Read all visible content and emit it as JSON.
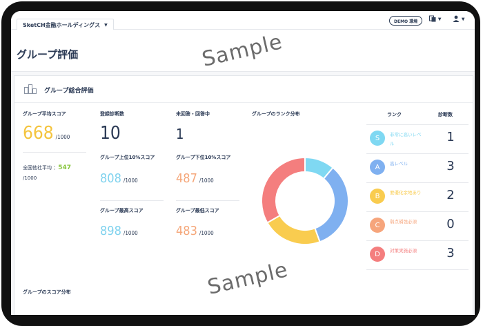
{
  "header": {
    "company": "SketCH金融ホールディングス",
    "demo_badge": "DEMO 環境",
    "page_title": "グループ評価"
  },
  "card": {
    "title": "グループ総合評価",
    "avg_score": {
      "label": "グループ平均スコア",
      "value": "668",
      "unit": "/1000"
    },
    "peer_avg": {
      "label": "全国他社平均 ：",
      "value": "547",
      "unit": "/1000"
    },
    "registered": {
      "label": "登録診断数",
      "value": "10"
    },
    "unanswered": {
      "label": "未回答・回答中",
      "value": "1"
    },
    "top10": {
      "label": "グループ上位10%スコア",
      "value": "808",
      "unit": "/1000"
    },
    "bottom10": {
      "label": "グループ下位10%スコア",
      "value": "487",
      "unit": "/1000"
    },
    "max": {
      "label": "グループ最高スコア",
      "value": "898",
      "unit": "/1000"
    },
    "min": {
      "label": "グループ最低スコア",
      "value": "483",
      "unit": "/1000"
    },
    "rank_dist_label": "グループのランク分布",
    "score_dist_label": "グループのスコア分布"
  },
  "rank_table": {
    "col_rank": "ランク",
    "col_count": "診断数",
    "rows": [
      {
        "letter": "S",
        "desc": "非常に高いレベル",
        "count": "1",
        "color": "#7fd8f2"
      },
      {
        "letter": "A",
        "desc": "高レベル",
        "count": "3",
        "color": "#7fb0f0"
      },
      {
        "letter": "B",
        "desc": "要優化余地あり",
        "count": "2",
        "color": "#f9cc4f"
      },
      {
        "letter": "C",
        "desc": "弱点補強必須",
        "count": "0",
        "color": "#f6a57c"
      },
      {
        "letter": "D",
        "desc": "対策実施必須",
        "count": "3",
        "color": "#f47e7e"
      }
    ]
  },
  "colors": {
    "avg": "#f4c43e",
    "peer": "#8ac640",
    "top": "#7fd2ee",
    "bottom": "#f5a77a"
  },
  "watermarks": [
    "Sample",
    "Sample"
  ]
}
